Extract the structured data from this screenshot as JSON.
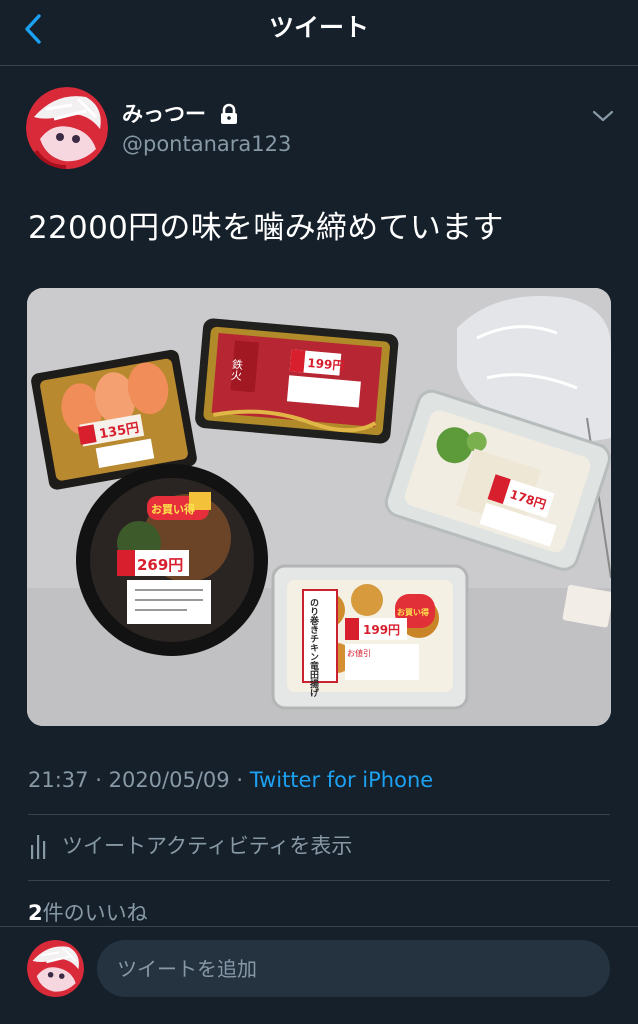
{
  "header": {
    "title": "ツイート",
    "back_icon": "chevron-left-icon"
  },
  "colors": {
    "background": "#15202b",
    "accent": "#1da1f2",
    "secondary_text": "#8899a6",
    "divider": "#38444d"
  },
  "tweet": {
    "display_name": "みっつー",
    "protected": true,
    "handle": "@pontanara123",
    "text": "22000円の味を噛み締めています",
    "media": {
      "labels": {
        "sushi_price": "135円",
        "tuna_price": "199円",
        "bowl_price": "269円",
        "tempura_price": "199円",
        "salad_price": "178円",
        "bowl_sticker": "お買い得",
        "tempura_sticker": "お買い得",
        "tuna_label": "鉄火",
        "tempura_title": "のり巻きチキン竜田揚げ",
        "discount_tag": "お値引"
      }
    },
    "time": "21:37",
    "separator": "·",
    "date": "2020/05/09",
    "source": "Twitter for iPhone"
  },
  "activity": {
    "label": "ツイートアクティビティを表示",
    "icon": "bar-chart-icon"
  },
  "likes": {
    "count": "2",
    "label": "件のいいね"
  },
  "compose": {
    "placeholder": "ツイートを追加"
  }
}
